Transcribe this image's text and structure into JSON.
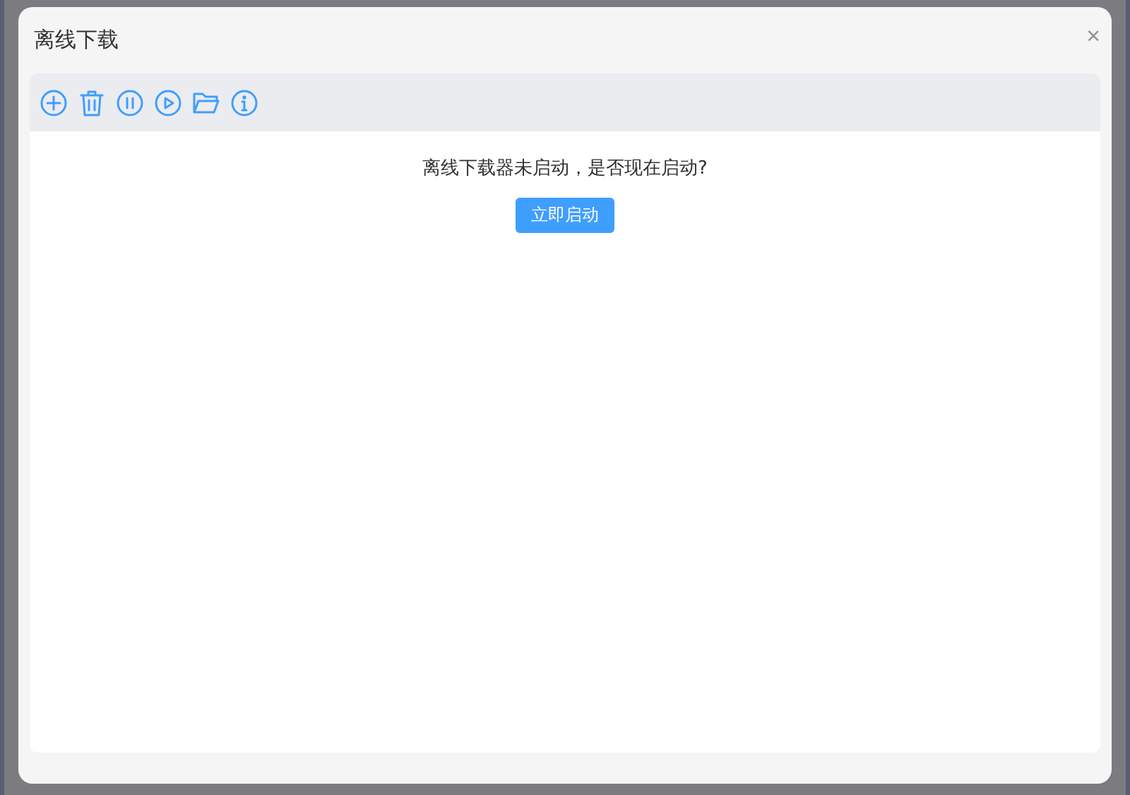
{
  "dialog": {
    "title": "离线下载",
    "close": "×"
  },
  "toolbar": {
    "buttons": [
      {
        "kind": "add"
      },
      {
        "kind": "delete"
      },
      {
        "kind": "pause"
      },
      {
        "kind": "play"
      },
      {
        "kind": "folder"
      },
      {
        "kind": "info"
      }
    ]
  },
  "message": "离线下载器未启动，是否现在启动?",
  "start_button": "立即启动"
}
